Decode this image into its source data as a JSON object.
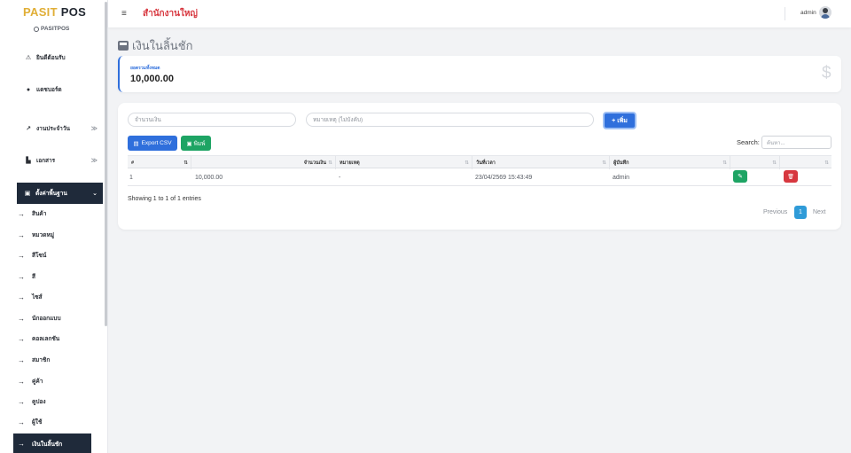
{
  "app": {
    "logo_part1": "PASIT",
    "logo_part2": "POS",
    "brand_sub": "PASITPOS"
  },
  "sidebar": {
    "items": [
      {
        "label": "ยินดีต้อนรับ",
        "icon": "handshake-icon",
        "glyph": "⚠"
      },
      {
        "label": "แดชบอร์ด",
        "icon": "info-icon",
        "glyph": "●"
      },
      {
        "label": "งานประจำวัน",
        "icon": "trend-icon",
        "glyph": "↗",
        "chevron": "≫"
      },
      {
        "label": "เอกสาร",
        "icon": "document-icon",
        "glyph": "▙",
        "chevron": "≫"
      },
      {
        "label": "ตั้งค่าพื้นฐาน",
        "icon": "printer-icon",
        "glyph": "▣",
        "chevron": "⌄"
      }
    ],
    "sub_items": [
      "สินค้า",
      "หมวดหมู่",
      "สีโซน์",
      "สี",
      "ไซส์",
      "นักออกแบบ",
      "คอลเลกชัน",
      "สมาชิก",
      "คู่ค้า",
      "คูปอง",
      "ผู้ใช้",
      "เงินในลิ้นชัก"
    ]
  },
  "topbar": {
    "menu_glyph": "≡",
    "branch": "สำนักงานใหญ่",
    "user": "admin"
  },
  "page": {
    "title": "เงินในลิ้นชัก"
  },
  "summary": {
    "label": "ยอดรวมทั้งหมด",
    "value": "10,000.00",
    "icon_glyph": "$"
  },
  "form": {
    "amount_placeholder": "จำนวนเงิน",
    "note_placeholder": "หมายเหตุ (ไม่บังคับ)",
    "add_label": "+ เพิ่ม"
  },
  "toolbar": {
    "csv_label": "Export CSV",
    "print_label": "พิมพ์",
    "search_label": "Search:",
    "search_placeholder": "ค้นหา..."
  },
  "table": {
    "headers": [
      "#",
      "จำนวนเงิน",
      "หมายเหตุ",
      "วันที่เวลา",
      "ผู้บันทึก",
      "",
      ""
    ],
    "sort_glyph": "⇅",
    "sort_active_glyph": "⇅",
    "rows": [
      {
        "no": "1",
        "amount": "10,000.00",
        "note": "-",
        "datetime": "23/04/2569 15:43:49",
        "user": "admin"
      }
    ],
    "edit_glyph": "✎",
    "delete_glyph": "🗑"
  },
  "footer": {
    "entries": "Showing 1 to 1 of 1 entries",
    "prev": "Previous",
    "page": "1",
    "next": "Next"
  },
  "colors": {
    "primary": "#2f6fdc",
    "success": "#1ea464",
    "danger": "#d7373f",
    "brand_gold": "#e0ae36",
    "sidebar_active": "#1f2a3a"
  }
}
